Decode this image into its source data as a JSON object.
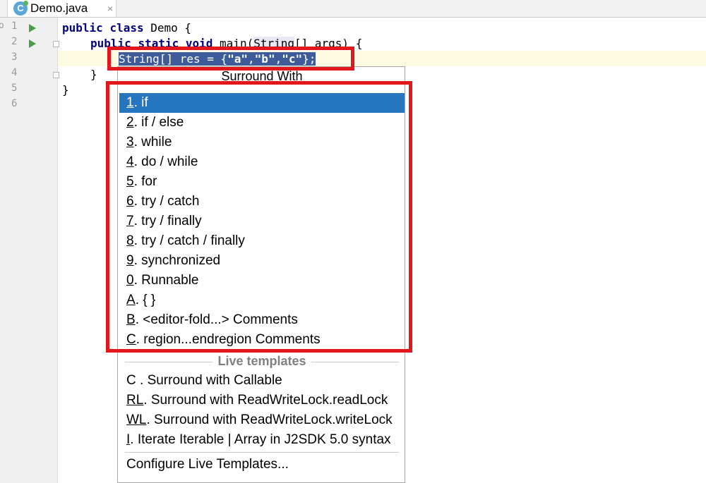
{
  "tab": {
    "icon_letter": "C",
    "title": "Demo.java",
    "close": "×"
  },
  "gutter": {
    "edge_label": "o",
    "line_numbers": [
      "1",
      "2",
      "3",
      "4",
      "5",
      "6"
    ]
  },
  "code": {
    "line1": {
      "kw1": "public",
      "kw2": "class",
      "rest": " Demo {"
    },
    "line2": {
      "kw1": "public",
      "kw2": "static",
      "kw3": "void",
      "rest_a": " main(",
      "type": "String",
      "rest_b": "[] args) {"
    },
    "line3": {
      "pre": "String[] res = {",
      "s1": "\"a\"",
      "c1": ",",
      "s2": "\"b\"",
      "c2": ",",
      "s3": "\"c\"",
      "post": "};"
    },
    "line4": "}",
    "line5": "}"
  },
  "popup": {
    "title": "Surround With",
    "items": [
      {
        "key": "1",
        "label": ". if"
      },
      {
        "key": "2",
        "label": ". if / else"
      },
      {
        "key": "3",
        "label": ". while"
      },
      {
        "key": "4",
        "label": ". do / while"
      },
      {
        "key": "5",
        "label": ". for"
      },
      {
        "key": "6",
        "label": ". try / catch"
      },
      {
        "key": "7",
        "label": ". try / finally"
      },
      {
        "key": "8",
        "label": ". try / catch / finally"
      },
      {
        "key": "9",
        "label": ". synchronized"
      },
      {
        "key": "0",
        "label": ". Runnable"
      },
      {
        "key": "A",
        "label": ". { }"
      },
      {
        "key": "B",
        "label": ". <editor-fold...> Comments"
      },
      {
        "key": "C",
        "label": ". region...endregion Comments"
      }
    ],
    "live_templates_label": "Live templates",
    "live_templates": [
      {
        "key": "C",
        "label": " . Surround with Callable"
      },
      {
        "key": "RL",
        "label": ". Surround with ReadWriteLock.readLock"
      },
      {
        "key": "WL",
        "label": ". Surround with ReadWriteLock.writeLock"
      },
      {
        "key": "I",
        "label": ". Iterate Iterable | Array in J2SDK 5.0 syntax"
      }
    ],
    "configure_label": "Configure Live Templates..."
  },
  "colors": {
    "selection": "#2675bf",
    "annotation": "#e2161b",
    "keyword": "#000080"
  }
}
